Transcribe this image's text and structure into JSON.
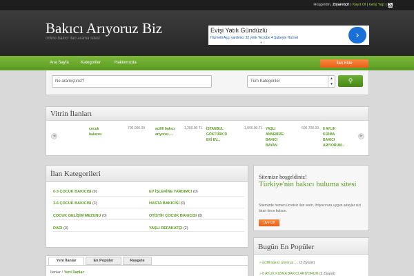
{
  "topbar": {
    "greeting": "Hoşgeldin,",
    "user": "Ziyaretçi!",
    "sep1": "|",
    "register": "Kayıt Ol",
    "sep2": "|",
    "login": "Giriş Yap",
    "sep3": "|"
  },
  "header": {
    "logo": "Bakıcı Arıyoruz Biz",
    "tagline": "online bakıcı ilan arama sitesi"
  },
  "ad": {
    "title": "Evişi Yatılı Gündüzlü",
    "subtitle": "Hizmetli Aşçı yardımcı 32 yıllık Tecrübe 4 Şubeyle Hizmet",
    "arrow": "›",
    "dots": "●○"
  },
  "nav": {
    "items": [
      "Ana Sayfa",
      "Kategoriler",
      "Hakkımızda"
    ],
    "cta": "İlan Ekle"
  },
  "search": {
    "placeholder": "Ne aramıştınız?",
    "category": "Tüm Kategoriler",
    "dd_up": "▲",
    "dd_down": "▼",
    "button_icon": "⚲"
  },
  "vitrin": {
    "title": "Vitrin İlanları",
    "prev": "◀",
    "next": "▶",
    "items": [
      {
        "name": "çocuk\nbakıcısı",
        "price": "700,000.00"
      },
      {
        "name": "acillll bakıcı\narıyoruz.....",
        "price": "1,250.00 TL"
      },
      {
        "name": "İSTANBUL\nGÖKTÜRK'D\nEKİ EV...",
        "price": "1,000.00 TL"
      },
      {
        "name": "YAŞLI\nANNEMİZE\nBAKICI\nBAYAN",
        "price": "600,700.00"
      },
      {
        "name": "8 AYLIK\nKIZIMA\nBAKICI\nARIYORUM..."
      }
    ]
  },
  "categories": {
    "title": "İlan Kategorileri",
    "left": [
      {
        "name": "0-3 ÇOCUK BAKICISI",
        "count": "(9)"
      },
      {
        "name": "3-6 ÇOCUK BAKICISI",
        "count": "(3)"
      },
      {
        "name": "ÇOCUK GELİŞİM MEZUNU",
        "count": "(0)"
      },
      {
        "name": "DADI",
        "count": "(3)"
      }
    ],
    "right": [
      {
        "name": "EV İŞLERİNE YARDIMCI",
        "count": "(0)"
      },
      {
        "name": "HASTA BAKICISI",
        "count": "(0)"
      },
      {
        "name": "OTİSTİK ÇOCUK BAKICISI",
        "count": "(0)"
      },
      {
        "name": "YAŞLI REFAKATÇI",
        "count": "(2)"
      }
    ]
  },
  "welcome": {
    "line1": "Sitemize hoşgeldiniz!",
    "line2": "Türkiye'nin bakıcı buluma sitesi",
    "body": "Sitemizde hemen ücretsiz ilan verin, ihtiyacınıza uygun adaylar sizi biran önce bulsun.",
    "button": "Üye Ol!"
  },
  "popular": {
    "title": "Bugün En Popüler",
    "items": [
      {
        "name": "acillll bakıcı arıyoruz.....",
        "count": "(3 Ziyaret)"
      },
      {
        "name": "8 AYLIK KIZIMA BAKICI ARIYORUM",
        "count": "(2 Ziyaret)"
      }
    ]
  },
  "tabs": {
    "items": [
      "Yeni İlanlar",
      "En Popüler",
      "Rasgele"
    ],
    "crumb_root": "İlanlar",
    "crumb_sep": " / ",
    "crumb_current": "Yeni İlanlar"
  }
}
